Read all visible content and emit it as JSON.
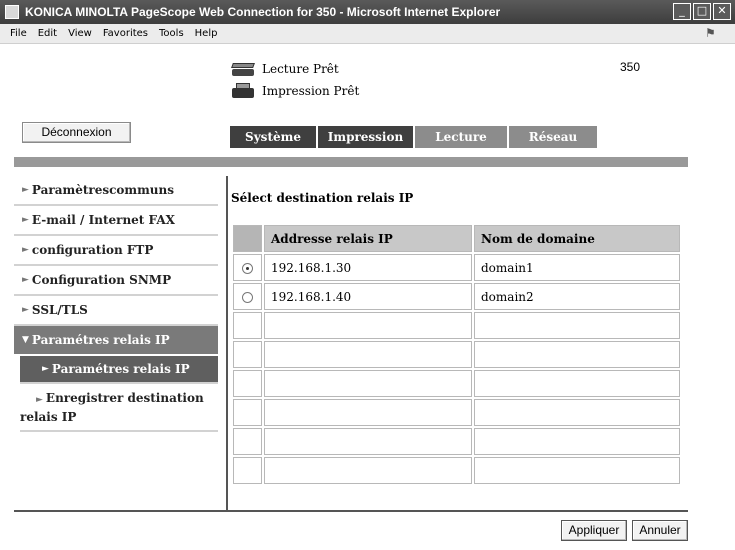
{
  "window": {
    "title": "KONICA MINOLTA PageScope Web Connection for 350 - Microsoft Internet Explorer",
    "controls": [
      "_",
      "□",
      "✕"
    ]
  },
  "menubar": [
    "File",
    "Edit",
    "View",
    "Favorites",
    "Tools",
    "Help"
  ],
  "header": {
    "scan_status": "Lecture Prêt",
    "print_status": "Impression Prêt",
    "model": "350",
    "logout_label": "Déconnexion"
  },
  "tabs": [
    {
      "label": "Système",
      "active": true
    },
    {
      "label": "Impression",
      "active": true
    },
    {
      "label": "Lecture",
      "active": false
    },
    {
      "label": "Réseau",
      "active": false
    }
  ],
  "sidebar": {
    "items": [
      {
        "label": "Paramètrescommuns"
      },
      {
        "label": "E-mail / Internet FAX"
      },
      {
        "label": "configuration FTP"
      },
      {
        "label": "Configuration SNMP"
      },
      {
        "label": "SSL/TLS"
      },
      {
        "label": "Paramétres relais IP"
      }
    ],
    "subitems": [
      {
        "label": "Paramétres relais IP"
      },
      {
        "line1": "Enregistrer destination",
        "line2": "relais IP"
      }
    ]
  },
  "main": {
    "title": "Sélect destination relais IP",
    "columns": [
      "Addresse relais IP",
      "Nom de domaine"
    ],
    "rows": [
      {
        "ip": "192.168.1.30",
        "domain": "domain1",
        "selected": true
      },
      {
        "ip": "192.168.1.40",
        "domain": "domain2",
        "selected": false
      }
    ]
  },
  "footer": {
    "apply_label": "Appliquer",
    "cancel_label": "Annuler"
  },
  "colors": {
    "titlebar": "#3d3d3d",
    "tab_active": "#3f3f3f",
    "tab_inactive": "#8c8c8c",
    "separator": "#999999",
    "sidebar_expanded": "#7a7a7a",
    "sidebar_sub_active": "#5f5f5f",
    "table_header": "#c8c8c8"
  }
}
